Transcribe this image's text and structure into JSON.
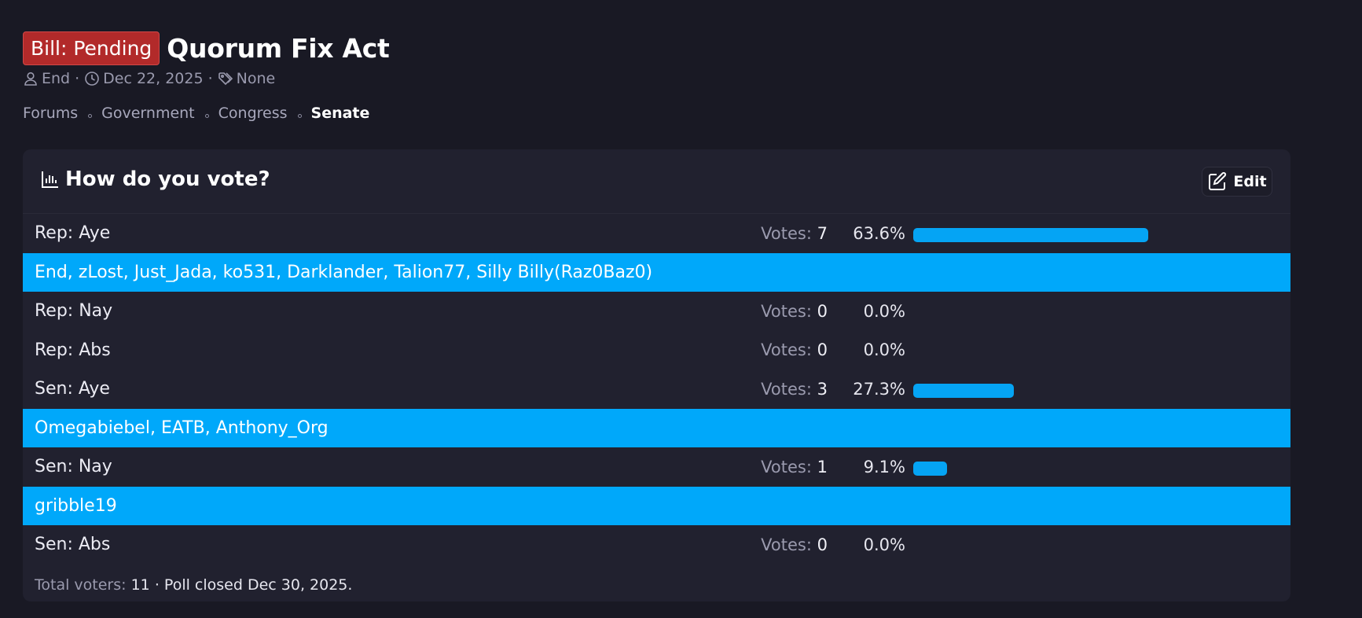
{
  "thread": {
    "prefix": "Bill: Pending",
    "title": "Quorum Fix Act",
    "author": "End",
    "date": "Dec 22, 2025",
    "tags": "None",
    "prefix_color": "#b22a2a"
  },
  "breadcrumb": [
    "Forums",
    "Government",
    "Congress",
    "Senate"
  ],
  "poll": {
    "question": "How do you vote?",
    "edit_label": "Edit",
    "votes_label": "Votes:",
    "bar_color": "#05a4f4",
    "voters_bg": "#00a8fa",
    "options": [
      {
        "label": "Rep: Aye",
        "votes": "7",
        "percent": "63.6%",
        "fraction": 0.636,
        "voters": "End, zLost, Just_Jada, ko531, Darklander, Talion77, Silly Billy(Raz0Baz0)"
      },
      {
        "label": "Rep: Nay",
        "votes": "0",
        "percent": "0.0%",
        "fraction": 0
      },
      {
        "label": "Rep: Abs",
        "votes": "0",
        "percent": "0.0%",
        "fraction": 0
      },
      {
        "label": "Sen: Aye",
        "votes": "3",
        "percent": "27.3%",
        "fraction": 0.273,
        "voters": "Omegabiebel, EATB, Anthony_Org"
      },
      {
        "label": "Sen: Nay",
        "votes": "1",
        "percent": "9.1%",
        "fraction": 0.091,
        "voters": "gribble19"
      },
      {
        "label": "Sen: Abs",
        "votes": "0",
        "percent": "0.0%",
        "fraction": 0
      }
    ],
    "footer": {
      "total_label": "Total voters:",
      "total": "11",
      "closed": "Poll closed Dec 30, 2025."
    }
  }
}
